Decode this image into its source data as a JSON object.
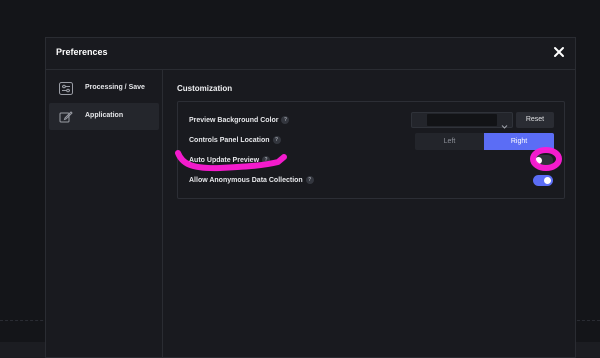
{
  "modal": {
    "title": "Preferences",
    "close_icon": "close-icon"
  },
  "sidebar": {
    "items": [
      {
        "label": "Processing / Save",
        "icon": "sliders-icon",
        "active": false
      },
      {
        "label": "Application",
        "icon": "edit-app-icon",
        "active": true
      }
    ]
  },
  "content": {
    "section_title": "Customization",
    "settings": {
      "preview_bg": {
        "label": "Preview Background Color",
        "help": "?",
        "reset_label": "Reset"
      },
      "controls_location": {
        "label": "Controls Panel Location",
        "help": "?",
        "options": [
          "Left",
          "Right"
        ],
        "selected": "Right"
      },
      "auto_update": {
        "label": "Auto Update Preview",
        "help": "?",
        "enabled": false
      },
      "anon_data": {
        "label": "Allow Anonymous Data Collection",
        "help": "?",
        "enabled": true
      }
    }
  },
  "colors": {
    "accent": "#5b6df5",
    "highlight": "#ff1bd6",
    "background": "#141519",
    "panel": "#191a1f"
  }
}
